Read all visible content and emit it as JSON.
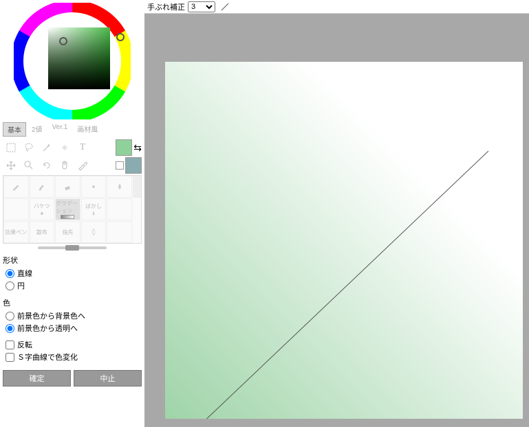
{
  "toolbar": {
    "stabilizer_label": "手ぶれ補正",
    "stabilizer_value": "3"
  },
  "tabs": [
    "基本",
    "2値",
    "Ver.1",
    "画材風"
  ],
  "active_tab": 0,
  "swatches": {
    "fg": "#8fd19a",
    "bg": "#8aabb0"
  },
  "subtools": {
    "row1": [
      "",
      "バケツ",
      "グラデーション",
      "ぼかし",
      ""
    ],
    "row2": [
      "効果ペン",
      "散布",
      "指先",
      "",
      ""
    ]
  },
  "shape": {
    "title": "形状",
    "options": [
      "直線",
      "円"
    ],
    "selected": 0
  },
  "color_dir": {
    "title": "色",
    "options": [
      "前景色から背景色へ",
      "前景色から透明へ"
    ],
    "selected": 1
  },
  "checks": {
    "invert": "反転",
    "scurve": "Ｓ字曲線で色変化"
  },
  "buttons": {
    "confirm": "確定",
    "cancel": "中止"
  }
}
